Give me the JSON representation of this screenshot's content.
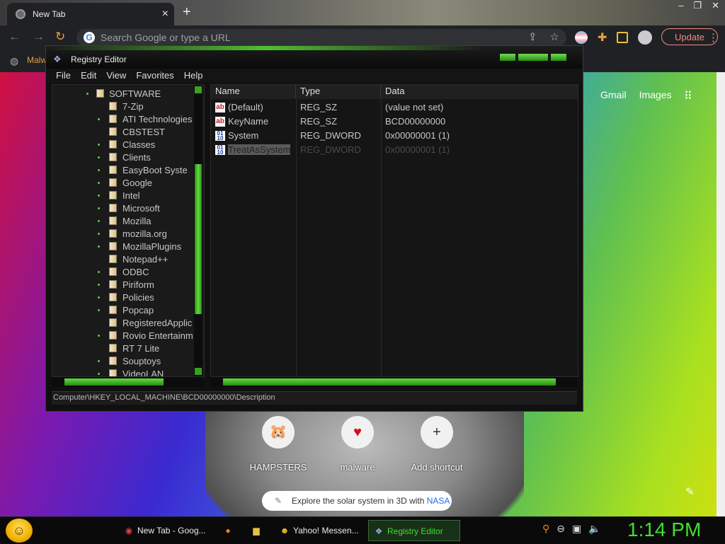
{
  "browser": {
    "tab_title": "New Tab",
    "close_icon": "×",
    "new_tab_icon": "+",
    "window_controls": [
      "‒",
      "❐",
      "✕"
    ],
    "omnibox_placeholder": "Search Google or type a URL",
    "update_label": "Update",
    "bookmark_label": "Malw",
    "accent": "#f28b82"
  },
  "newtab": {
    "links": [
      "Gmail",
      "Images"
    ],
    "shortcuts": [
      {
        "label": "HAMPSTERS",
        "icon": "hamster-icon"
      },
      {
        "label": "malware",
        "icon": "heart-icon"
      },
      {
        "label": "Add shortcut",
        "icon": "plus-icon"
      }
    ],
    "promo_text": "Explore the solar system in 3D with",
    "promo_link": "NASA"
  },
  "regedit": {
    "title": "Registry Editor",
    "menu": [
      "File",
      "Edit",
      "View",
      "Favorites",
      "Help"
    ],
    "tree": {
      "root": "SOFTWARE",
      "children": [
        {
          "label": "7-Zip",
          "dot": false
        },
        {
          "label": "ATI Technologies",
          "dot": true
        },
        {
          "label": "CBSTEST",
          "dot": false
        },
        {
          "label": "Classes",
          "dot": true
        },
        {
          "label": "Clients",
          "dot": true
        },
        {
          "label": "EasyBoot Syste",
          "dot": true
        },
        {
          "label": "Google",
          "dot": true
        },
        {
          "label": "Intel",
          "dot": true
        },
        {
          "label": "Microsoft",
          "dot": true
        },
        {
          "label": "Mozilla",
          "dot": true
        },
        {
          "label": "mozilla.org",
          "dot": true
        },
        {
          "label": "MozillaPlugins",
          "dot": true
        },
        {
          "label": "Notepad++",
          "dot": false
        },
        {
          "label": "ODBC",
          "dot": true
        },
        {
          "label": "Piriform",
          "dot": true
        },
        {
          "label": "Policies",
          "dot": true
        },
        {
          "label": "Popcap",
          "dot": true
        },
        {
          "label": "RegisteredApplic",
          "dot": false
        },
        {
          "label": "Rovio Entertainm",
          "dot": true
        },
        {
          "label": "RT 7 Lite",
          "dot": false
        },
        {
          "label": "Souptoys",
          "dot": true
        },
        {
          "label": "VideoLAN",
          "dot": true
        }
      ]
    },
    "columns": [
      "Name",
      "Type",
      "Data"
    ],
    "values": [
      {
        "name": "(Default)",
        "type": "REG_SZ",
        "data": "(value not set)",
        "icon": "string-value-icon"
      },
      {
        "name": "KeyName",
        "type": "REG_SZ",
        "data": "BCD00000000",
        "icon": "string-value-icon"
      },
      {
        "name": "System",
        "type": "REG_DWORD",
        "data": "0x00000001 (1)",
        "icon": "binary-value-icon"
      },
      {
        "name": "TreatAsSystem",
        "type": "REG_DWORD",
        "data": "0x00000001 (1)",
        "icon": "binary-value-icon"
      }
    ],
    "status_path": "Computer\\HKEY_LOCAL_MACHINE\\BCD00000000\\Description"
  },
  "taskbar": {
    "items": [
      {
        "label": "New Tab - Goog...",
        "icon": "chrome-icon",
        "active": false
      },
      {
        "label": "",
        "icon": "firefox-icon",
        "active": false
      },
      {
        "label": "",
        "icon": "folder-icon",
        "active": false
      },
      {
        "label": "Yahoo! Messen...",
        "icon": "yahoo-messenger-icon",
        "active": false
      },
      {
        "label": "Registry Editor",
        "icon": "regedit-icon",
        "active": true
      }
    ],
    "clock": "1:14 PM",
    "clock_color": "#3fe030"
  }
}
